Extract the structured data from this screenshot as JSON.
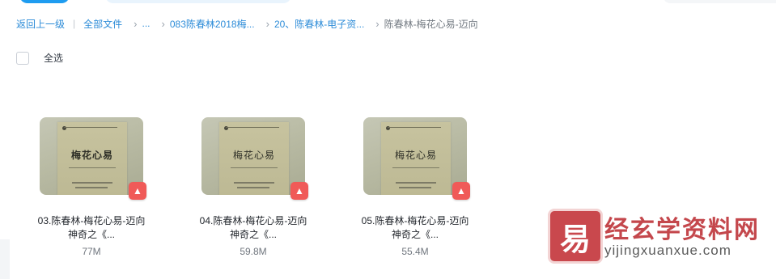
{
  "breadcrumb": {
    "back": "返回上一级",
    "all_files": "全部文件",
    "ellipsis": "...",
    "folder1": "083陈春林2018梅...",
    "folder2": "20、陈春林-电子资...",
    "current": "陈春林-梅花心易-迈向"
  },
  "toolbar": {
    "select_all": "全选"
  },
  "files": [
    {
      "name_line1": "03.陈春林-梅花心易-迈向",
      "name_line2": "神奇之《...",
      "size": "77M",
      "badge": "PDF"
    },
    {
      "name_line1": "04.陈春林-梅花心易-迈向",
      "name_line2": "神奇之《...",
      "size": "59.8M",
      "badge": "PDF"
    },
    {
      "name_line1": "05.陈春林-梅花心易-迈向",
      "name_line2": "神奇之《...",
      "size": "55.4M",
      "badge": "PDF"
    }
  ],
  "watermark": {
    "logo_char": "易",
    "title": "经玄学资料网",
    "url": "yijingxuanxue.com"
  },
  "colors": {
    "accent": "#2d8cd8",
    "pdf_badge": "#f05a58",
    "watermark": "#c4474c"
  }
}
